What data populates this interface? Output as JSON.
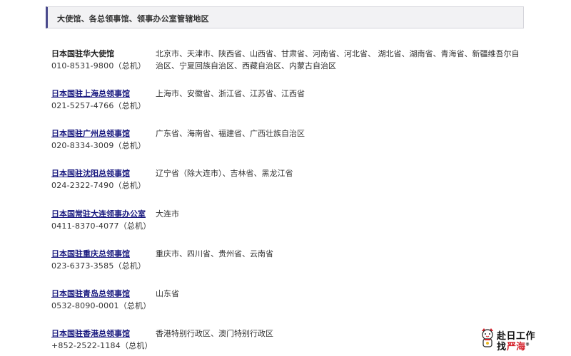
{
  "header": {
    "title": "大使馆、各总领事馆、领事办公室管辖地区"
  },
  "offices": [
    {
      "name": "日本国驻华大使馆",
      "link": false,
      "phone": "010-8531-9800（总机）",
      "region": "北京市、天津市、陕西省、山西省、甘肃省、河南省、河北省、 湖北省、湖南省、青海省、新疆维吾尔自治区、宁夏回族自治区、西藏自治区、内蒙古自治区"
    },
    {
      "name": "日本国驻上海总领事馆",
      "link": true,
      "phone": "021-5257-4766（总机）",
      "region": "上海市、安徽省、浙江省、江苏省、江西省"
    },
    {
      "name": "日本国驻广州总领事馆",
      "link": true,
      "phone": "020-8334-3009（总机）",
      "region": "广东省、海南省、福建省、广西壮族自治区"
    },
    {
      "name": "日本国驻沈阳总领事馆",
      "link": true,
      "phone": "024-2322-7490（总机）",
      "region": "辽宁省（除大连市）、吉林省、黑龙江省"
    },
    {
      "name": "日本国常驻大连领事办公室",
      "link": true,
      "phone": "0411-8370-4077（总机）",
      "region": "大连市"
    },
    {
      "name": "日本国驻重庆总领事馆",
      "link": true,
      "phone": "023-6373-3585（总机）",
      "region": "重庆市、四川省、贵州省、云南省"
    },
    {
      "name": "日本国驻青岛总领事馆",
      "link": true,
      "phone": "0532-8090-0001（总机）",
      "region": "山东省"
    },
    {
      "name": "日本国驻香港总领事馆",
      "link": true,
      "phone": "+852-2522-1184（总机）",
      "region": "香港特别行政区、澳门特别行政区"
    }
  ],
  "logo": {
    "line1": "赴日工作",
    "line2a": "找",
    "line2b": "严海",
    "mark": "®",
    "accent": "#d4202a"
  },
  "colors": {
    "link": "#1a1a80",
    "header_bar": "#4a4a8c",
    "header_bg": "#f2f2f4"
  }
}
